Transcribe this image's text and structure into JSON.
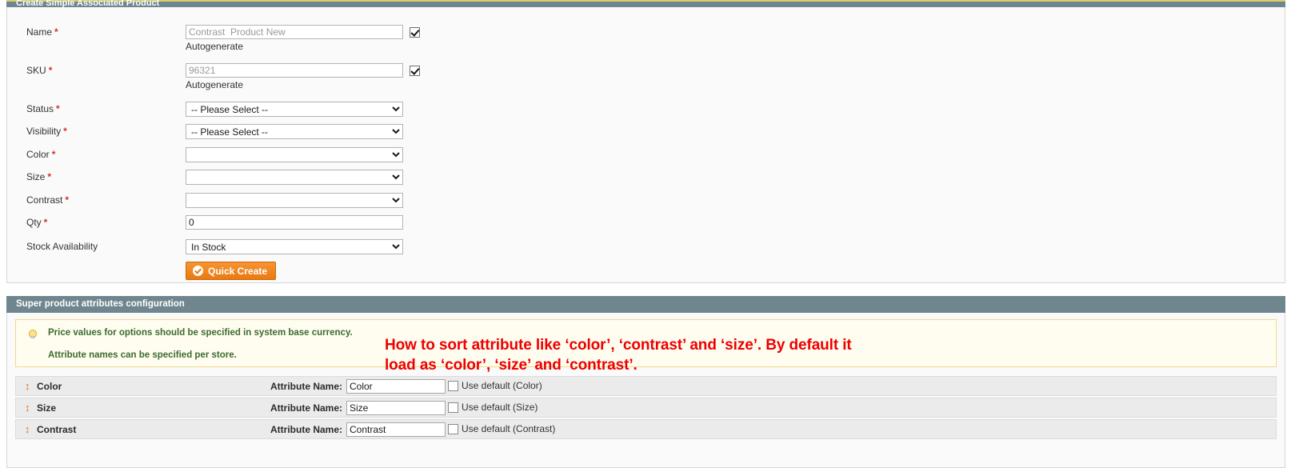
{
  "quick_create": {
    "header_hidden_title": "Create Simple Associated Product",
    "fields": [
      {
        "label": "Name",
        "required": true,
        "type": "text",
        "value": "Contrast  Product New",
        "muted": true,
        "checkbox_checked": true,
        "helper": "Autogenerate"
      },
      {
        "label": "SKU",
        "required": true,
        "type": "text",
        "value": "96321",
        "muted": true,
        "checkbox_checked": true,
        "helper": "Autogenerate"
      },
      {
        "label": "Status",
        "required": true,
        "type": "select",
        "value": "-- Please Select --"
      },
      {
        "label": "Visibility",
        "required": true,
        "type": "select",
        "value": "-- Please Select --"
      },
      {
        "label": "Color",
        "required": true,
        "type": "select",
        "value": ""
      },
      {
        "label": "Size",
        "required": true,
        "type": "select",
        "value": ""
      },
      {
        "label": "Contrast",
        "required": true,
        "type": "select",
        "value": ""
      },
      {
        "label": "Qty",
        "required": true,
        "type": "text",
        "value": "0",
        "muted": false,
        "checkbox_checked": null,
        "helper": ""
      },
      {
        "label": "Stock Availability",
        "required": false,
        "type": "select",
        "value": "In Stock"
      }
    ],
    "submit_label": "Quick Create"
  },
  "super_attributes": {
    "panel_title": "Super product attributes configuration",
    "notice": {
      "line1": "Price values for options should be specified in system base currency.",
      "line2": "Attribute names can be specified per store.",
      "icon": "lightbulb-icon"
    },
    "annotation": "How to sort attribute like ‘color’, ‘contrast’ and ‘size’. By default it\nload as ‘color’, ‘size’ and ‘contrast’.",
    "attribute_name_label": "Attribute Name:",
    "rows": [
      {
        "title": "Color",
        "attribute_name_label": "Attribute Name:",
        "attribute_name_value": "Color",
        "use_default_label": "Use default (Color)",
        "use_default_checked": false,
        "drag_icon": "drag-vertical-icon"
      },
      {
        "title": "Size",
        "attribute_name_label": "Attribute Name:",
        "attribute_name_value": "Size",
        "use_default_label": "Use default (Size)",
        "use_default_checked": false,
        "drag_icon": "drag-vertical-icon"
      },
      {
        "title": "Contrast",
        "attribute_name_label": "Attribute Name:",
        "attribute_name_value": "Contrast",
        "use_default_label": "Use default (Contrast)",
        "use_default_checked": false,
        "drag_icon": "drag-vertical-icon"
      }
    ]
  },
  "colors": {
    "panel_header": "#6f868f",
    "accent_orange": "#e97a10",
    "annotation_red": "#ee0000",
    "notice_bg": "#fffdf0",
    "notice_border": "#f0d98a",
    "notice_text": "#3c6b2f",
    "required_star": "#d42f2f"
  }
}
